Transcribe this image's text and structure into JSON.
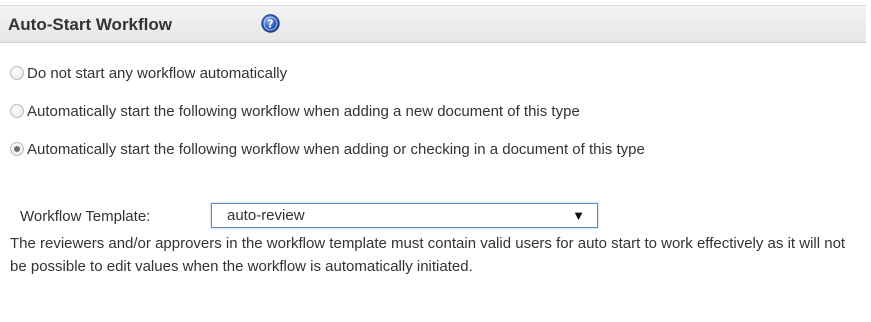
{
  "header": {
    "title": "Auto-Start Workflow",
    "help_icon": "help-question-icon"
  },
  "options": [
    {
      "label": "Do not start any workflow automatically",
      "checked": false
    },
    {
      "label": "Automatically start the following workflow when adding a new document of this type",
      "checked": false
    },
    {
      "label": "Automatically start the following workflow when adding or checking in a document of this type",
      "checked": true
    }
  ],
  "template": {
    "label": "Workflow Template:",
    "selected": "auto-review"
  },
  "note": "The reviewers and/or approvers in the workflow template must contain valid users for auto start to work effectively as it will not be possible to edit values when the workflow is automatically initiated.",
  "colors": {
    "header_bg": "#e9e9e9",
    "help_icon": "#2f5fbf",
    "select_border": "#5a8bc5"
  }
}
